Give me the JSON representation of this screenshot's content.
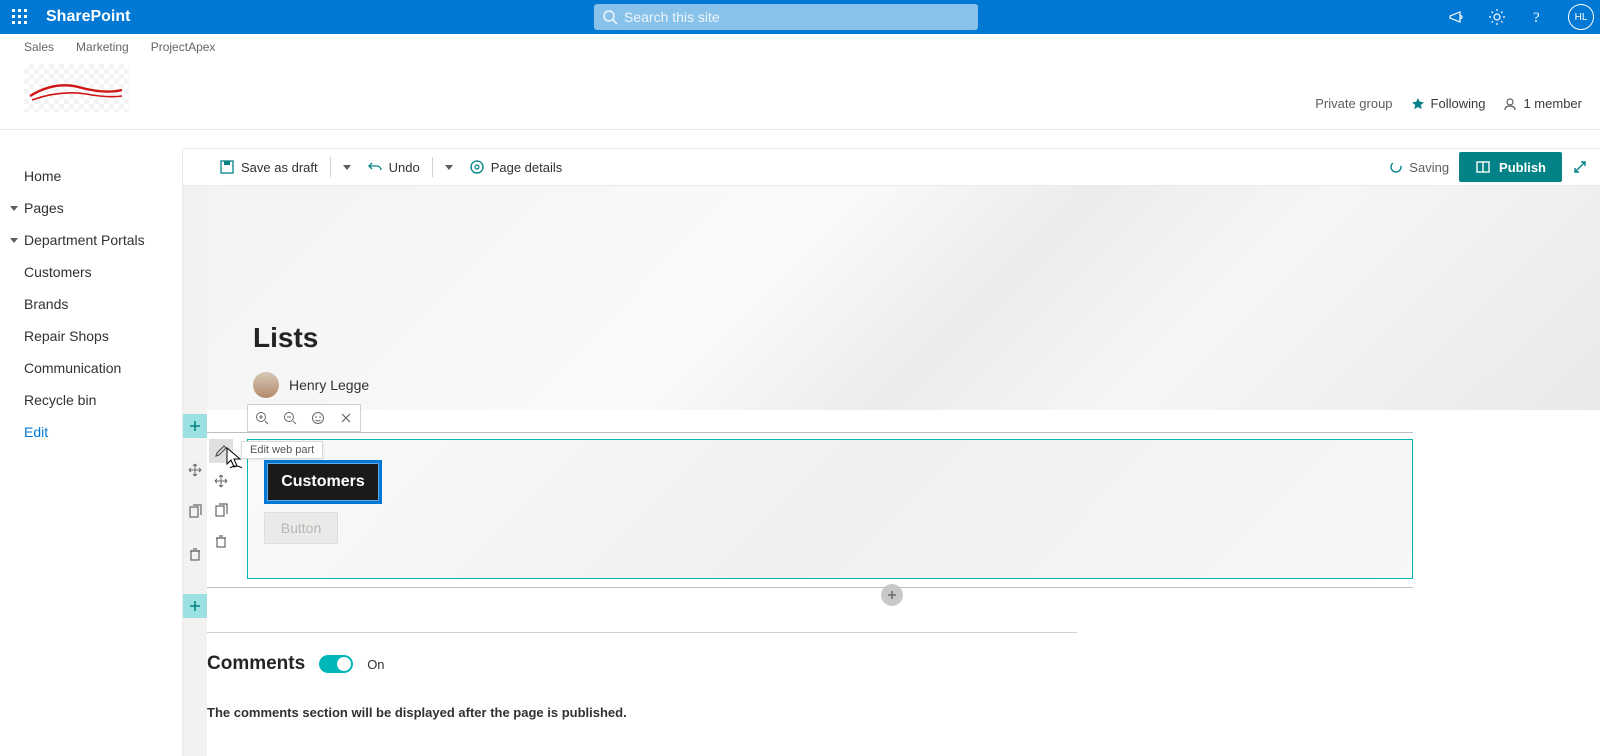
{
  "suite": {
    "brand": "SharePoint",
    "search_placeholder": "Search this site",
    "avatar": "HL"
  },
  "hub_links": [
    "Sales",
    "Marketing",
    "ProjectApex"
  ],
  "group_info": {
    "privacy": "Private group",
    "follow": "Following",
    "members": "1 member"
  },
  "cmd": {
    "save": "Save as draft",
    "undo": "Undo",
    "details": "Page details",
    "saving": "Saving",
    "publish": "Publish"
  },
  "nav": {
    "home": "Home",
    "pages": "Pages",
    "dept": "Department Portals",
    "items": [
      "Customers",
      "Brands",
      "Repair Shops",
      "Communication",
      "Recycle bin"
    ],
    "edit": "Edit"
  },
  "page": {
    "title": "Lists",
    "author": "Henry Legge"
  },
  "tooltip": "Edit web part",
  "buttons": {
    "customers": "Customers",
    "placeholder": "Button"
  },
  "comments": {
    "title": "Comments",
    "state": "On",
    "note": "The comments section will be displayed after the page is published."
  }
}
